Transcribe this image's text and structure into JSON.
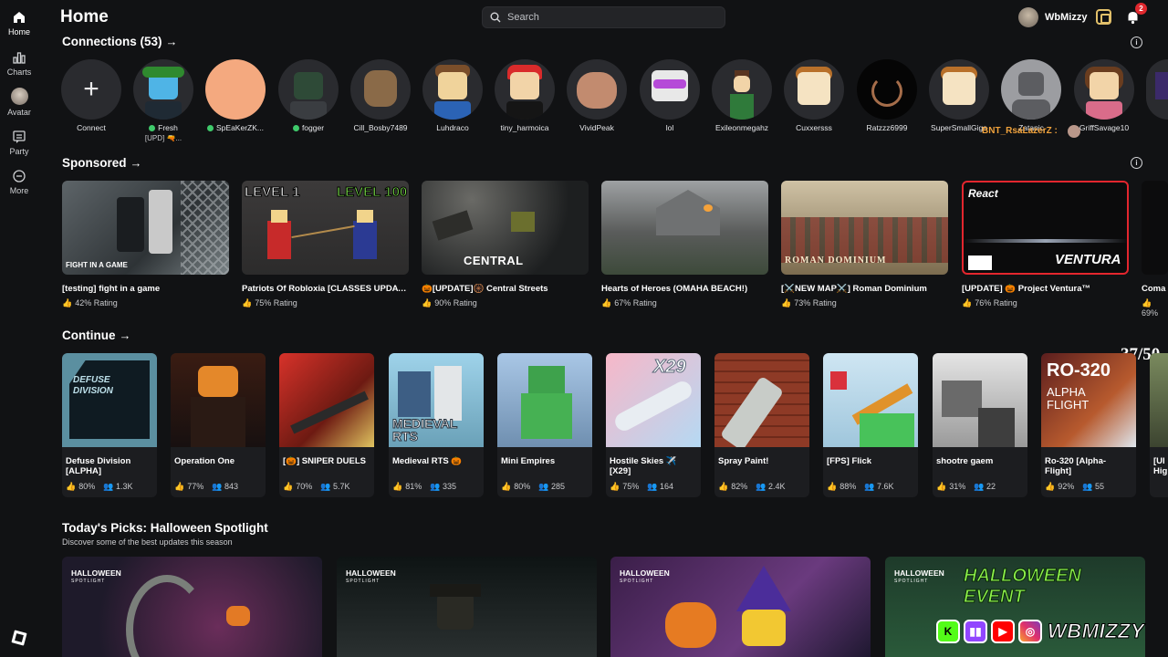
{
  "rail": {
    "items": [
      {
        "label": "Home"
      },
      {
        "label": "Charts"
      },
      {
        "label": "Avatar"
      },
      {
        "label": "Party"
      },
      {
        "label": "More"
      }
    ]
  },
  "header": {
    "title": "Home",
    "search_placeholder": "Search",
    "username": "WbMizzy",
    "notifications": "2"
  },
  "connections": {
    "title": "Connections (53)",
    "items": [
      {
        "name": "Connect",
        "online": false
      },
      {
        "name": "Fresh",
        "online": true,
        "sub": "[UPD] 🔫..."
      },
      {
        "name": "SpEaKerZK...",
        "online": true
      },
      {
        "name": "fogger",
        "online": true
      },
      {
        "name": "Cill_Bosby7489",
        "online": false
      },
      {
        "name": "Luhdraco",
        "online": false
      },
      {
        "name": "tiny_harmoica",
        "online": false
      },
      {
        "name": "VividPeak",
        "online": false
      },
      {
        "name": "lol",
        "online": false
      },
      {
        "name": "Exileonmegahz",
        "online": false
      },
      {
        "name": "Cuxxersss",
        "online": false
      },
      {
        "name": "Ratzzz6999",
        "online": false
      },
      {
        "name": "SuperSmallGiga",
        "online": false
      },
      {
        "name": "Zatanic",
        "online": false
      },
      {
        "name": "GriffSavage10",
        "online": false
      }
    ]
  },
  "overlay": {
    "chat_name": "BNT_RsaLazerZ :"
  },
  "sponsored": {
    "title": "Sponsored",
    "items": [
      {
        "title": "[testing] fight in a game",
        "rating": "42% Rating",
        "thumb_text": "FIGHT IN A GAME"
      },
      {
        "title": "Patriots Of Robloxia [CLASSES UPDATE]",
        "rating": "75% Rating",
        "thumb_text_a": "LEVEL 1",
        "thumb_text_b": "LEVEL 100"
      },
      {
        "title": "🎃[UPDATE]🛞 Central Streets",
        "rating": "90% Rating",
        "thumb_text": "CENTRAL"
      },
      {
        "title": "Hearts of Heroes (OMAHA BEACH!)",
        "rating": "67% Rating"
      },
      {
        "title": "[⚔️NEW MAP⚔️] Roman Dominium",
        "rating": "73% Rating",
        "thumb_text": "ROMAN DOMINIUM"
      },
      {
        "title": "[UPDATE] 🎃 Project Ventura™",
        "rating": "76% Rating",
        "thumb_text_a": "React",
        "thumb_text_b": "VENTURA"
      },
      {
        "title": "Coma",
        "rating": "69%"
      }
    ]
  },
  "continue": {
    "title": "Continue",
    "counter": "37/50",
    "items": [
      {
        "title": "Defuse Division [ALPHA]",
        "rating": "80%",
        "players": "1.3K",
        "thumb_text": "DEFUSE DIVISION"
      },
      {
        "title": "Operation One",
        "rating": "77%",
        "players": "843"
      },
      {
        "title": "[🎃] SNIPER DUELS",
        "rating": "70%",
        "players": "5.7K"
      },
      {
        "title": "Medieval RTS 🎃",
        "rating": "81%",
        "players": "335",
        "thumb_text": "MEDIEVAL RTS"
      },
      {
        "title": "Mini Empires",
        "rating": "80%",
        "players": "285"
      },
      {
        "title": "Hostile Skies ✈️ [X29]",
        "rating": "75%",
        "players": "164",
        "thumb_text": "X29"
      },
      {
        "title": "Spray Paint!",
        "rating": "82%",
        "players": "2.4K"
      },
      {
        "title": "[FPS] Flick",
        "rating": "88%",
        "players": "7.6K"
      },
      {
        "title": "shootre gaem",
        "rating": "31%",
        "players": "22"
      },
      {
        "title": "Ro-320 [Alpha-Flight]",
        "rating": "92%",
        "players": "55",
        "thumb_text_a": "RO-320",
        "thumb_text_b": "ALPHA FLIGHT"
      },
      {
        "title": "[UI Hig",
        "rating": "",
        "players": ""
      }
    ]
  },
  "picks": {
    "title": "Today's Picks: Halloween Spotlight",
    "subtitle": "Discover some of the best updates this season",
    "tag": "HALLOWEEN",
    "tag_sub": "SPOTLIGHT",
    "event_text": "HALLOWEEN EVENT"
  },
  "social": {
    "handle": "WBMIZZY"
  }
}
